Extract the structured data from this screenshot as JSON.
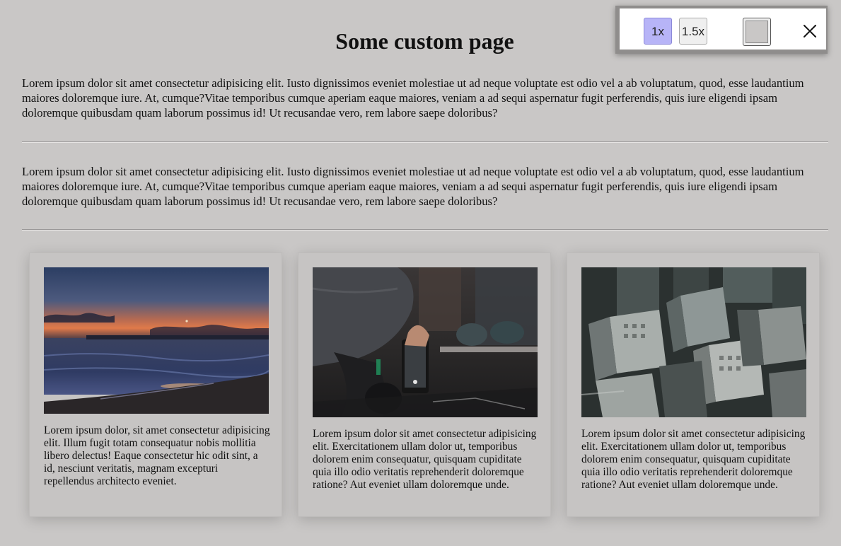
{
  "page": {
    "title": "Some custom page",
    "paragraph_1": "Lorem ipsum dolor sit amet consectetur adipisicing elit. Iusto dignissimos eveniet molestiae ut ad neque voluptate est odio vel a ab voluptatum, quod, esse laudantium maiores doloremque iure. At, cumque?Vitae temporibus cumque aperiam eaque maiores, veniam a ad sequi aspernatur fugit perferendis, quis iure eligendi ipsam doloremque quibusdam quam laborum possimus id! Ut recusandae vero, rem labore saepe doloribus?",
    "paragraph_2": "Lorem ipsum dolor sit amet consectetur adipisicing elit. Iusto dignissimos eveniet molestiae ut ad neque voluptate est odio vel a ab voluptatum, quod, esse laudantium maiores doloremque iure. At, cumque?Vitae temporibus cumque aperiam eaque maiores, veniam a ad sequi aspernatur fugit perferendis, quis iure eligendi ipsam doloremque quibusdam quam laborum possimus id! Ut recusandae vero, rem labore saepe doloribus?"
  },
  "cards": [
    {
      "image": "sunset-beach-photo",
      "text": "Lorem ipsum dolor, sit amet consectetur adipisicing elit. Illum fugit totam consequatur nobis mollitia libero delectus! Eaque consectetur hic odit sint, a id, nesciunt veritatis, magnam excepturi repellendus architecto eveniet."
    },
    {
      "image": "phone-photographer-photo",
      "text": "Lorem ipsum dolor sit amet consectetur adipisicing elit. Exercitationem ullam dolor ut, temporibus dolorem enim consequatur, quisquam cupiditate quia illo odio veritatis reprehenderit doloremque ratione? Aut eveniet ullam doloremque unde."
    },
    {
      "image": "city-aerial-photo",
      "text": "Lorem ipsum dolor sit amet consectetur adipisicing elit. Exercitationem ullam dolor ut, temporibus dolorem enim consequatur, quisquam cupiditate quia illo odio veritatis reprehenderit doloremque ratione? Aut eveniet ullam doloremque unde."
    }
  ],
  "toolbar": {
    "zoom_1x_label": "1x",
    "zoom_15x_label": "1.5x",
    "selected_zoom": "1x",
    "active_color": "#b7b4f7",
    "swatch_color": "#c9c7c6",
    "close_icon": "close-icon"
  }
}
